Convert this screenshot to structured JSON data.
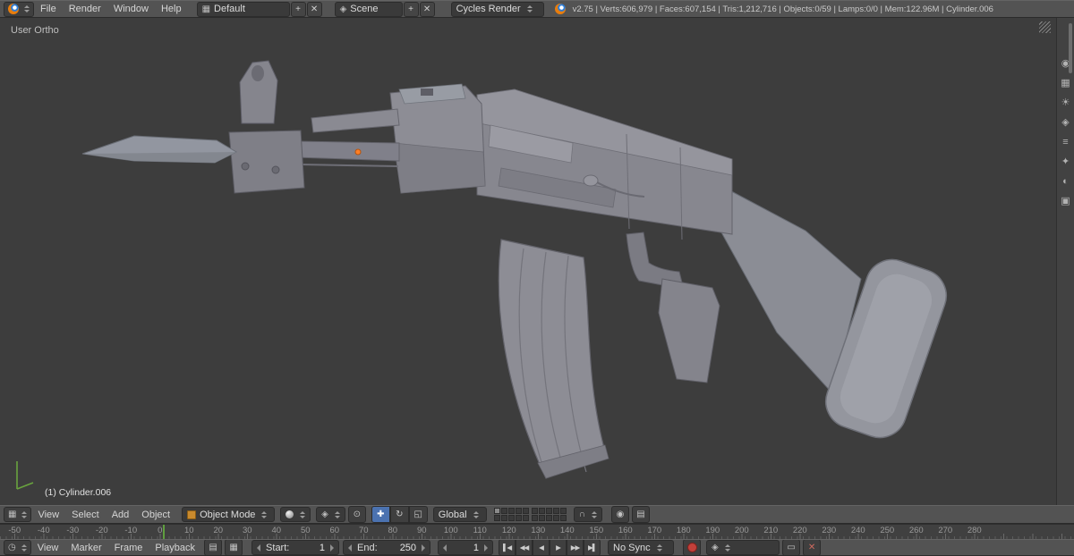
{
  "glyphs": {
    "plus": "+",
    "close": "✕",
    "grid": "▦",
    "magnet": "∩",
    "camera": "◉",
    "film": "▤",
    "clock": "◷",
    "pivot": "◈",
    "center": "⊙",
    "key_a": "▭",
    "key_b": "✕"
  },
  "top_header": {
    "menus": [
      "File",
      "Render",
      "Window",
      "Help"
    ],
    "layout": {
      "value": "Default"
    },
    "scene": {
      "value": "Scene"
    },
    "engine": {
      "value": "Cycles Render"
    },
    "stats": "v2.75 | Verts:606,979 | Faces:607,154 | Tris:1,212,716 | Objects:0/59 | Lamps:0/0 | Mem:122.96M | Cylinder.006"
  },
  "viewport": {
    "view_label": "User Ortho",
    "active_object": "(1) Cylinder.006"
  },
  "view3d_header": {
    "menus": [
      "View",
      "Select",
      "Add",
      "Object"
    ],
    "mode": "Object Mode",
    "orientation": "Global",
    "manipulator_icons": [
      "✚",
      "↻",
      "◱"
    ]
  },
  "timeline": {
    "menus": [
      "View",
      "Marker",
      "Frame",
      "Playback"
    ],
    "ruler_ticks": [
      "-50",
      "-40",
      "-30",
      "-20",
      "-10",
      "0",
      "10",
      "20",
      "30",
      "40",
      "50",
      "60",
      "70",
      "80",
      "90",
      "100",
      "110",
      "120",
      "130",
      "140",
      "150",
      "160",
      "170",
      "180",
      "190",
      "200",
      "210",
      "220",
      "230",
      "240",
      "250",
      "260",
      "270",
      "280"
    ],
    "start_label": "Start:",
    "start_value": "1",
    "end_label": "End:",
    "end_value": "250",
    "current_frame": "1",
    "sync": "No Sync",
    "playback_icons": [
      "▌◀",
      "◀◀",
      "◀",
      "▶",
      "▶▶",
      "▶▌"
    ]
  },
  "right_panel": {
    "icons": [
      "◉",
      "▦",
      "☀",
      "◈",
      "≡",
      "✦",
      "◐",
      "▣"
    ]
  }
}
